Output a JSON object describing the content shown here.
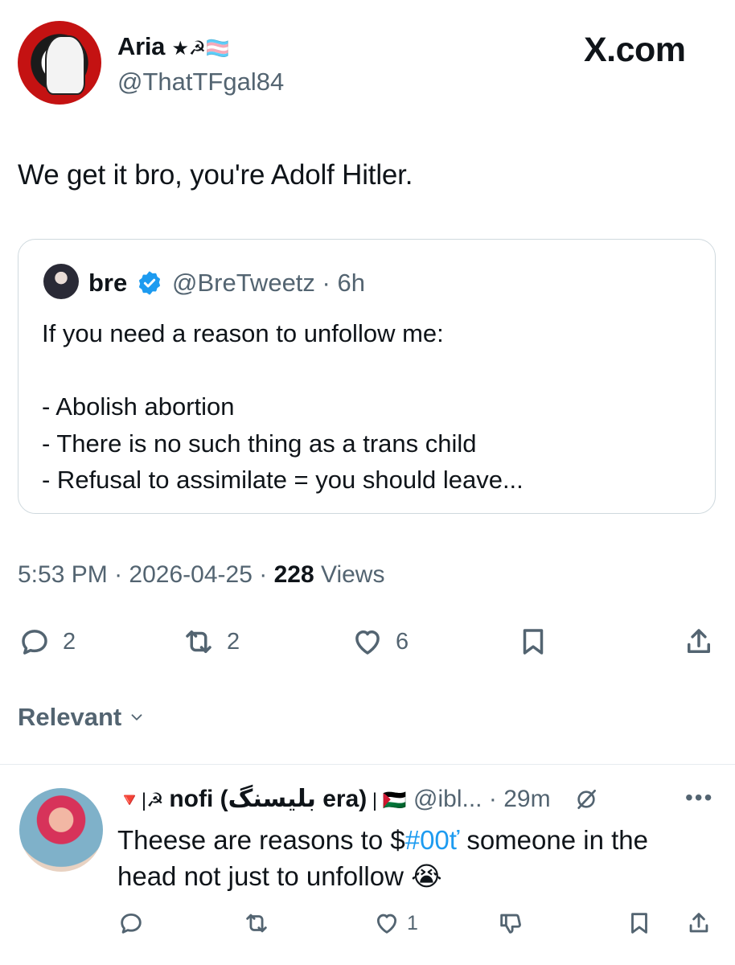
{
  "watermark": "X.com",
  "author": {
    "name": "Aria",
    "name_suffix": "★☭🏳️‍⚧️",
    "handle": "@ThatTFgal84"
  },
  "tweet": {
    "text": "We get it bro, you're Adolf Hitler."
  },
  "quoted": {
    "name": "bre",
    "handle": "@BreTweetz",
    "sep": "·",
    "time": "6h",
    "text": "If you need a reason to unfollow me:\n\n- Abolish abortion\n- There is no such thing as a trans child\n- Refusal to assimilate = you should leave..."
  },
  "meta": {
    "time": "5:53 PM",
    "sep1": "·",
    "date": "2026-04-25",
    "sep2": "·",
    "views_count": "228",
    "views_label": "Views"
  },
  "actions": {
    "replies": "2",
    "reposts": "2",
    "likes": "6"
  },
  "sort": {
    "label": "Relevant"
  },
  "reply": {
    "name_prefix": "🔻|☭ ",
    "name": "nofi (بلیسنگ era)",
    "name_suffix": " | 🇵🇸",
    "handle": "@ibl...",
    "sep": "·",
    "time": "29m",
    "more": "•••",
    "text_before": "Theese are reasons to $",
    "hashtag": "#00ť",
    "text_after": " someone in the head not just to unfollow 😭",
    "likes": "1"
  },
  "colors": {
    "text": "#0f1419",
    "secondary": "#536471",
    "accent": "#1d9bf0",
    "border": "#cfd9de"
  }
}
